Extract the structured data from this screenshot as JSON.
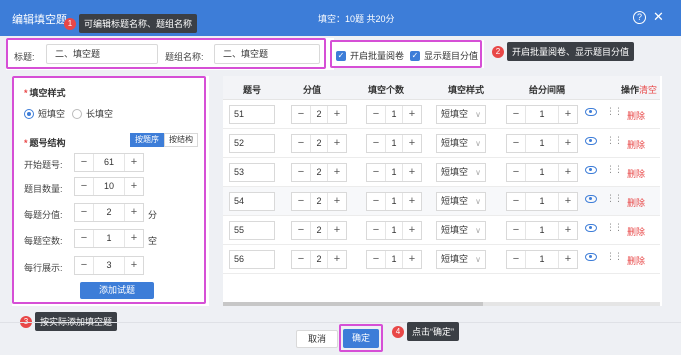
{
  "dialog": {
    "title": "编辑填空题",
    "summary": "填空：10题 共20分",
    "help": "?",
    "close": "✕"
  },
  "callouts": [
    {
      "num": "1",
      "text": "可编辑标题名称、题组名称"
    },
    {
      "num": "2",
      "text": "开启批量阅卷、显示题目分值"
    },
    {
      "num": "3",
      "text": "按实际添加填空题"
    },
    {
      "num": "4",
      "text": "点击“确定”"
    }
  ],
  "titleRow": {
    "title_label": "标题:",
    "title_value": "二、填空题",
    "group_label": "题组名称:",
    "group_value": "二、填空题"
  },
  "options": {
    "batch_label": "开启批量阅卷",
    "show_score_label": "显示题目分值"
  },
  "config": {
    "style_title": "填空样式",
    "style_short": "短填空",
    "style_long": "长填空",
    "structure_title": "题号结构",
    "seg_order": "按题序",
    "seg_structure": "按结构",
    "start_label": "开始题号:",
    "start_value": "61",
    "count_label": "题目数量:",
    "count_value": "10",
    "score_label": "每题分值:",
    "score_value": "2",
    "score_unit": "分",
    "blank_label": "每题空数:",
    "blank_value": "1",
    "blank_unit": "空",
    "perline_label": "每行展示:",
    "perline_value": "3",
    "add_button": "添加试题",
    "minus": "−",
    "plus": "+"
  },
  "table": {
    "headers": {
      "number": "题号",
      "score": "分值",
      "blanks": "填空个数",
      "style": "填空样式",
      "interval": "给分间隔",
      "ops": "操作",
      "clear": "清空"
    },
    "rows": [
      {
        "number": "51",
        "score": "2",
        "blanks": "1",
        "style": "短填空",
        "interval": "1",
        "delete": "删除"
      },
      {
        "number": "52",
        "score": "2",
        "blanks": "1",
        "style": "短填空",
        "interval": "1",
        "delete": "删除"
      },
      {
        "number": "53",
        "score": "2",
        "blanks": "1",
        "style": "短填空",
        "interval": "1",
        "delete": "删除"
      },
      {
        "number": "54",
        "score": "2",
        "blanks": "1",
        "style": "短填空",
        "interval": "1",
        "delete": "删除"
      },
      {
        "number": "55",
        "score": "2",
        "blanks": "1",
        "style": "短填空",
        "interval": "1",
        "delete": "删除"
      },
      {
        "number": "56",
        "score": "2",
        "blanks": "1",
        "style": "短填空",
        "interval": "1",
        "delete": "删除"
      }
    ],
    "stepper_minus": "−",
    "stepper_plus": "+",
    "drag": "⋮⋮",
    "dropdown_arrow": "∨"
  },
  "footer": {
    "cancel": "取消",
    "confirm": "确定"
  },
  "colors": {
    "primary": "#3d7dd8",
    "danger": "#e84747",
    "highlight": "#d64fd6"
  }
}
